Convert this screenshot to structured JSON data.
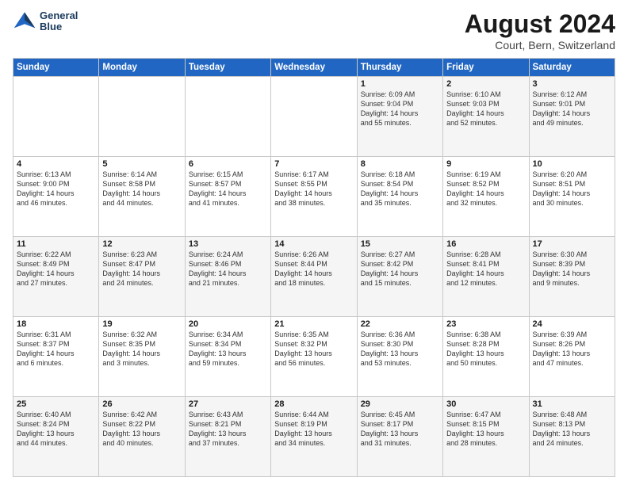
{
  "header": {
    "logo_line1": "General",
    "logo_line2": "Blue",
    "title": "August 2024",
    "subtitle": "Court, Bern, Switzerland"
  },
  "weekdays": [
    "Sunday",
    "Monday",
    "Tuesday",
    "Wednesday",
    "Thursday",
    "Friday",
    "Saturday"
  ],
  "weeks": [
    [
      {
        "day": "",
        "info": ""
      },
      {
        "day": "",
        "info": ""
      },
      {
        "day": "",
        "info": ""
      },
      {
        "day": "",
        "info": ""
      },
      {
        "day": "1",
        "info": "Sunrise: 6:09 AM\nSunset: 9:04 PM\nDaylight: 14 hours\nand 55 minutes."
      },
      {
        "day": "2",
        "info": "Sunrise: 6:10 AM\nSunset: 9:03 PM\nDaylight: 14 hours\nand 52 minutes."
      },
      {
        "day": "3",
        "info": "Sunrise: 6:12 AM\nSunset: 9:01 PM\nDaylight: 14 hours\nand 49 minutes."
      }
    ],
    [
      {
        "day": "4",
        "info": "Sunrise: 6:13 AM\nSunset: 9:00 PM\nDaylight: 14 hours\nand 46 minutes."
      },
      {
        "day": "5",
        "info": "Sunrise: 6:14 AM\nSunset: 8:58 PM\nDaylight: 14 hours\nand 44 minutes."
      },
      {
        "day": "6",
        "info": "Sunrise: 6:15 AM\nSunset: 8:57 PM\nDaylight: 14 hours\nand 41 minutes."
      },
      {
        "day": "7",
        "info": "Sunrise: 6:17 AM\nSunset: 8:55 PM\nDaylight: 14 hours\nand 38 minutes."
      },
      {
        "day": "8",
        "info": "Sunrise: 6:18 AM\nSunset: 8:54 PM\nDaylight: 14 hours\nand 35 minutes."
      },
      {
        "day": "9",
        "info": "Sunrise: 6:19 AM\nSunset: 8:52 PM\nDaylight: 14 hours\nand 32 minutes."
      },
      {
        "day": "10",
        "info": "Sunrise: 6:20 AM\nSunset: 8:51 PM\nDaylight: 14 hours\nand 30 minutes."
      }
    ],
    [
      {
        "day": "11",
        "info": "Sunrise: 6:22 AM\nSunset: 8:49 PM\nDaylight: 14 hours\nand 27 minutes."
      },
      {
        "day": "12",
        "info": "Sunrise: 6:23 AM\nSunset: 8:47 PM\nDaylight: 14 hours\nand 24 minutes."
      },
      {
        "day": "13",
        "info": "Sunrise: 6:24 AM\nSunset: 8:46 PM\nDaylight: 14 hours\nand 21 minutes."
      },
      {
        "day": "14",
        "info": "Sunrise: 6:26 AM\nSunset: 8:44 PM\nDaylight: 14 hours\nand 18 minutes."
      },
      {
        "day": "15",
        "info": "Sunrise: 6:27 AM\nSunset: 8:42 PM\nDaylight: 14 hours\nand 15 minutes."
      },
      {
        "day": "16",
        "info": "Sunrise: 6:28 AM\nSunset: 8:41 PM\nDaylight: 14 hours\nand 12 minutes."
      },
      {
        "day": "17",
        "info": "Sunrise: 6:30 AM\nSunset: 8:39 PM\nDaylight: 14 hours\nand 9 minutes."
      }
    ],
    [
      {
        "day": "18",
        "info": "Sunrise: 6:31 AM\nSunset: 8:37 PM\nDaylight: 14 hours\nand 6 minutes."
      },
      {
        "day": "19",
        "info": "Sunrise: 6:32 AM\nSunset: 8:35 PM\nDaylight: 14 hours\nand 3 minutes."
      },
      {
        "day": "20",
        "info": "Sunrise: 6:34 AM\nSunset: 8:34 PM\nDaylight: 13 hours\nand 59 minutes."
      },
      {
        "day": "21",
        "info": "Sunrise: 6:35 AM\nSunset: 8:32 PM\nDaylight: 13 hours\nand 56 minutes."
      },
      {
        "day": "22",
        "info": "Sunrise: 6:36 AM\nSunset: 8:30 PM\nDaylight: 13 hours\nand 53 minutes."
      },
      {
        "day": "23",
        "info": "Sunrise: 6:38 AM\nSunset: 8:28 PM\nDaylight: 13 hours\nand 50 minutes."
      },
      {
        "day": "24",
        "info": "Sunrise: 6:39 AM\nSunset: 8:26 PM\nDaylight: 13 hours\nand 47 minutes."
      }
    ],
    [
      {
        "day": "25",
        "info": "Sunrise: 6:40 AM\nSunset: 8:24 PM\nDaylight: 13 hours\nand 44 minutes."
      },
      {
        "day": "26",
        "info": "Sunrise: 6:42 AM\nSunset: 8:22 PM\nDaylight: 13 hours\nand 40 minutes."
      },
      {
        "day": "27",
        "info": "Sunrise: 6:43 AM\nSunset: 8:21 PM\nDaylight: 13 hours\nand 37 minutes."
      },
      {
        "day": "28",
        "info": "Sunrise: 6:44 AM\nSunset: 8:19 PM\nDaylight: 13 hours\nand 34 minutes."
      },
      {
        "day": "29",
        "info": "Sunrise: 6:45 AM\nSunset: 8:17 PM\nDaylight: 13 hours\nand 31 minutes."
      },
      {
        "day": "30",
        "info": "Sunrise: 6:47 AM\nSunset: 8:15 PM\nDaylight: 13 hours\nand 28 minutes."
      },
      {
        "day": "31",
        "info": "Sunrise: 6:48 AM\nSunset: 8:13 PM\nDaylight: 13 hours\nand 24 minutes."
      }
    ]
  ]
}
